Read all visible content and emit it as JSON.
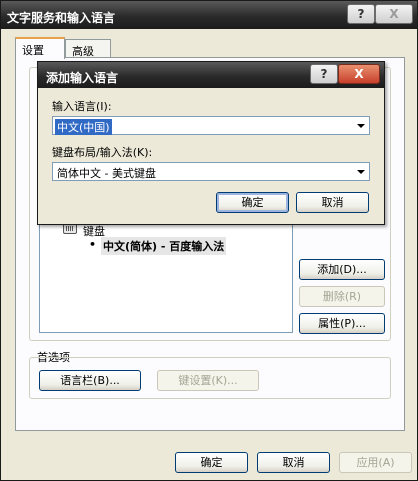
{
  "window": {
    "title": "文字服务和输入语言",
    "help_btn": "?",
    "close_btn": "X"
  },
  "tabs": [
    {
      "label": "设置",
      "active": true
    },
    {
      "label": "高级",
      "active": false
    }
  ],
  "installed_services": {
    "tree_category": "键盘",
    "tree_item": "中文(简体) - 百度输入法"
  },
  "side_buttons": {
    "add": "添加(D)...",
    "remove": "删除(R)",
    "properties": "属性(P)..."
  },
  "preferences": {
    "group_label": "首选项",
    "language_bar_btn": "语言栏(B)...",
    "key_settings_btn": "键设置(K)..."
  },
  "footer_buttons": {
    "ok": "确定",
    "cancel": "取消",
    "apply": "应用(A)"
  },
  "add_dialog": {
    "title": "添加输入语言",
    "help_btn": "?",
    "close_btn": "X",
    "input_language_label": "输入语言(I):",
    "input_language_value": "中文(中国)",
    "keyboard_layout_label": "键盘布局/输入法(K):",
    "keyboard_layout_value": "简体中文 - 美式键盘",
    "ok_btn": "确定",
    "cancel_btn": "取消"
  }
}
